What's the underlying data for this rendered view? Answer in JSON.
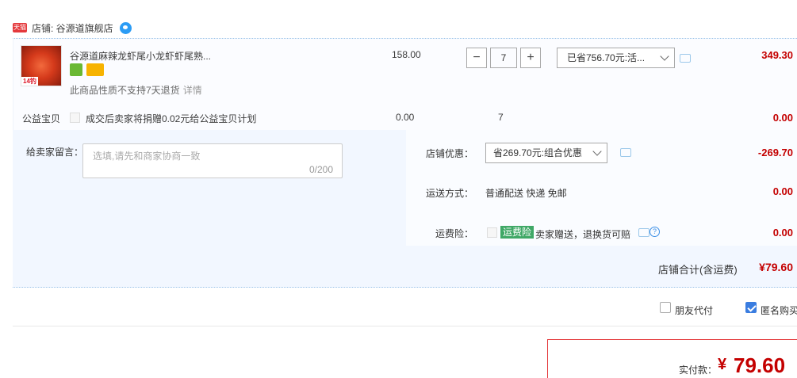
{
  "shop": {
    "badge": "天猫",
    "label": "店铺: 谷源道旗舰店",
    "chat_icon": "wangwang-icon"
  },
  "item": {
    "title": "谷源道麻辣龙虾尾小龙虾虾尾熟...",
    "thumb_tag": "14钓",
    "no_return": "此商品性质不支持7天退货",
    "detail_link": "详情",
    "price": "158.00",
    "qty_minus": "−",
    "quantity": "7",
    "qty_plus": "+",
    "promo": "已省756.70元:活...",
    "total": "349.30"
  },
  "charity": {
    "label": "公益宝贝",
    "text": "成交后卖家将捐赠0.02元给公益宝贝计划",
    "price": "0.00",
    "qty": "7",
    "total": "0.00"
  },
  "memo": {
    "label": "给卖家留言：",
    "placeholder": "选填,请先和商家协商一致",
    "count": "0/200"
  },
  "shop_promo": {
    "label": "店铺优惠：",
    "value": "省269.70元:组合优惠",
    "total": "-269.70"
  },
  "shipping": {
    "label": "运送方式：",
    "value": "普通配送 快递 免邮",
    "total": "0.00"
  },
  "insurance": {
    "label": "运费险：",
    "badge": "运费险",
    "text": "卖家赠送，退换货可赔",
    "total": "0.00"
  },
  "subtotal": {
    "label": "店铺合计(含运费)",
    "value": "¥79.60"
  },
  "options": {
    "friend_pay": "朋友代付",
    "anon": "匿名购买"
  },
  "payment": {
    "label": "实付款：",
    "yen": "¥",
    "value": "79.60"
  },
  "colors": {
    "price_red": "#c40000",
    "accent_blue": "#3a7de0",
    "bg_blue": "#f2f7ff"
  }
}
